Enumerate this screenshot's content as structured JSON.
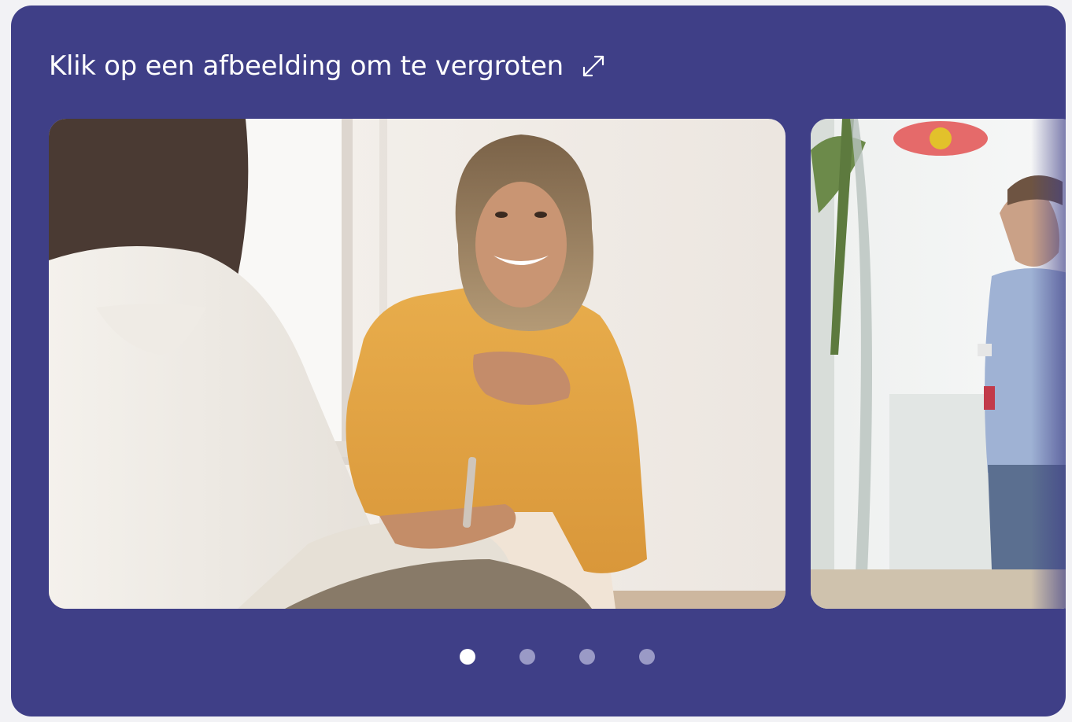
{
  "gallery": {
    "title": "Klik op een afbeelding om te vergroten",
    "expand_icon": "expand-arrows-icon",
    "slides": [
      {
        "description_icon": "photo-counseling-session",
        "active": true
      },
      {
        "description_icon": "photo-man-standing-by-window",
        "active": false
      }
    ],
    "pagination": {
      "total": 4,
      "current": 1
    }
  },
  "colors": {
    "card_background": "#3f3f87",
    "dot_active": "#ffffff",
    "dot_inactive": "#9a9ac6"
  }
}
